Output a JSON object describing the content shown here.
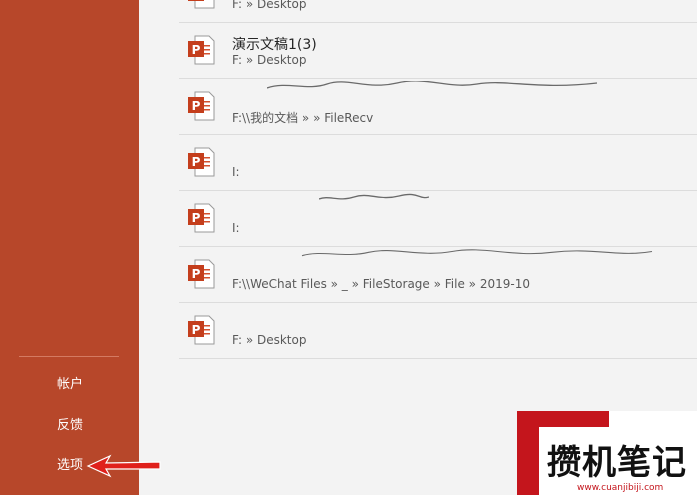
{
  "sidebar": {
    "items": [
      {
        "label": "帐户"
      },
      {
        "label": "反馈"
      },
      {
        "label": "选项"
      }
    ]
  },
  "recent": [
    {
      "title": "",
      "path": "F: » Desktop"
    },
    {
      "title": "演示文稿1(3)",
      "path": "F: » Desktop"
    },
    {
      "title": "",
      "path": "F:\\\\我的文档 »                 » FileRecv"
    },
    {
      "title": "",
      "path": "I:"
    },
    {
      "title": "",
      "path": "I:"
    },
    {
      "title": "",
      "path": "F:\\\\WeChat Files »          _ » FileStorage » File » 2019-10"
    },
    {
      "title": "",
      "path": "F: » Desktop"
    }
  ],
  "watermark": {
    "text": "攒机笔记",
    "url": "www.cuanjibiji.com"
  },
  "colors": {
    "sidebar": "#b7472a",
    "ppt_icon": "#c43e1c",
    "background": "#f3f3f3"
  }
}
